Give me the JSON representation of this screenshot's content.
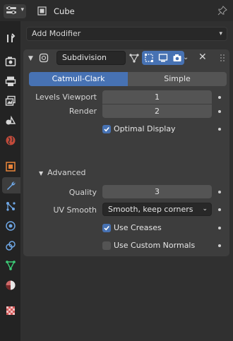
{
  "header": {
    "object_name": "Cube",
    "editor_icon": "properties-editor-icon",
    "pin_icon": "pin-icon"
  },
  "tabs": [
    {
      "name": "tool",
      "icon": "tool-icon",
      "active": false
    },
    {
      "name": "render",
      "icon": "render-icon",
      "active": false
    },
    {
      "name": "output",
      "icon": "output-icon",
      "active": false
    },
    {
      "name": "view-layer",
      "icon": "view-layer-icon",
      "active": false
    },
    {
      "name": "scene",
      "icon": "scene-icon",
      "active": false
    },
    {
      "name": "world",
      "icon": "world-icon",
      "active": false
    },
    {
      "name": "object",
      "icon": "object-icon",
      "active": false
    },
    {
      "name": "modifiers",
      "icon": "wrench-icon",
      "active": true
    },
    {
      "name": "particles",
      "icon": "particles-icon",
      "active": false
    },
    {
      "name": "physics",
      "icon": "physics-icon",
      "active": false
    },
    {
      "name": "constraints",
      "icon": "constraints-icon",
      "active": false
    },
    {
      "name": "data",
      "icon": "mesh-data-icon",
      "active": false
    },
    {
      "name": "material",
      "icon": "material-icon",
      "active": false
    },
    {
      "name": "texture",
      "icon": "texture-icon",
      "active": false
    }
  ],
  "add_modifier": {
    "label": "Add Modifier"
  },
  "modifier": {
    "name": "Subdivision",
    "mode": {
      "selected": "Catmull-Clark",
      "options": [
        "Catmull-Clark",
        "Simple"
      ]
    },
    "levels_viewport": {
      "label": "Levels Viewport",
      "value": "1"
    },
    "render": {
      "label": "Render",
      "value": "2"
    },
    "optimal_display": {
      "label": "Optimal Display",
      "checked": true
    },
    "advanced": {
      "label": "Advanced",
      "quality": {
        "label": "Quality",
        "value": "3"
      },
      "uv_smooth": {
        "label": "UV Smooth",
        "value": "Smooth, keep corners"
      },
      "use_creases": {
        "label": "Use Creases",
        "checked": true
      },
      "use_custom_normals": {
        "label": "Use Custom Normals",
        "checked": false
      }
    }
  },
  "colors": {
    "accent": "#4772b3",
    "panel": "#3d3d3d",
    "background": "#303030",
    "field": "#545454"
  }
}
